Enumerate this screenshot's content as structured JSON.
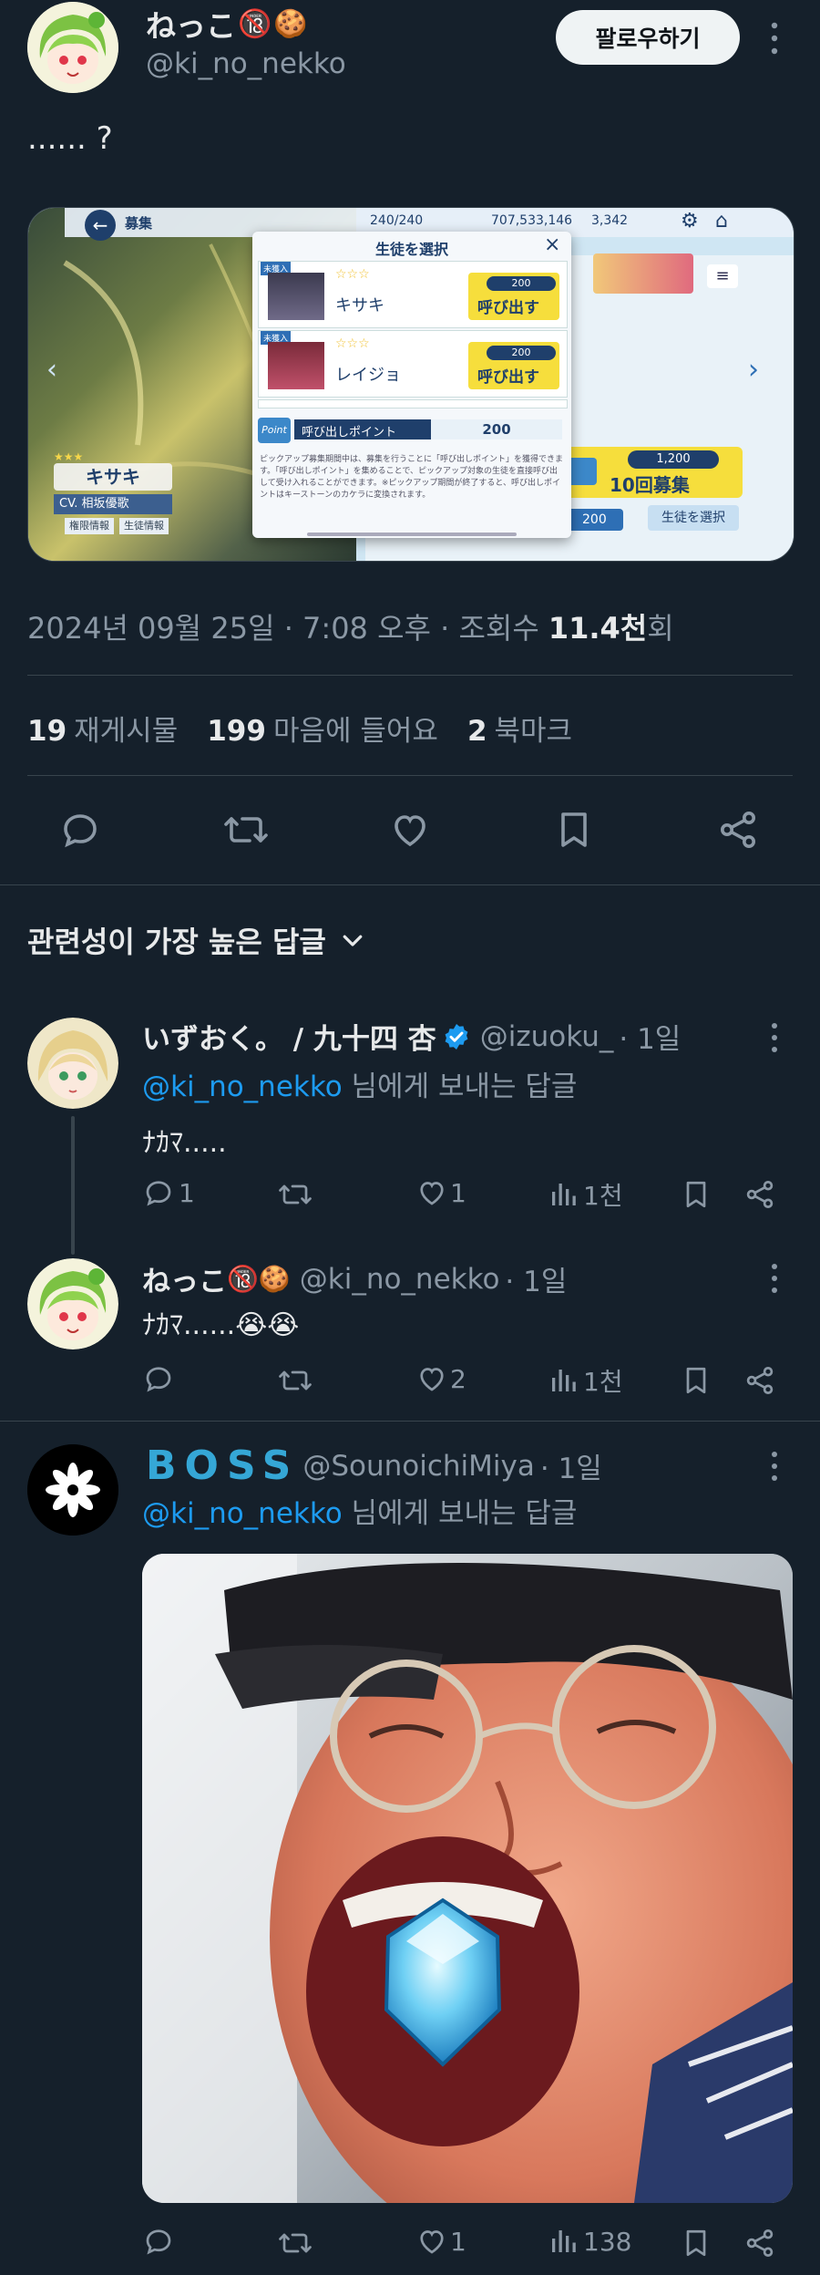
{
  "main_tweet": {
    "display_name": "ねっこ",
    "name_emoji_1": "🔞",
    "name_emoji_2": "🍪",
    "handle": "@ki_no_nekko",
    "follow_label": "팔로우하기",
    "text": "...... ?",
    "timestamp": "2024년 09월 25일 · 7:08 오후 · 조회수",
    "views": "11.4천",
    "views_suffix": "회",
    "retweets_count": "19",
    "retweets_label": "재게시물",
    "likes_count": "199",
    "likes_label": "마음에 들어요",
    "bookmarks_count": "2",
    "bookmarks_label": "북마크"
  },
  "embedded_game": {
    "header_title": "募集",
    "ap": "240/240",
    "credits": "707,533,146",
    "gems": "3,342",
    "dialog_title": "生徒を選択",
    "students": [
      {
        "badge": "未獲入",
        "name": "キサキ",
        "cost": "200",
        "button": "呼び出す"
      },
      {
        "badge": "未獲入",
        "name": "レイジョ",
        "cost": "200",
        "button": "呼び出す"
      }
    ],
    "point_label": "呼び出しポイント",
    "point_value": "200",
    "point_tag": "Point",
    "note_text": "ピックアップ募集期間中は、募集を行うことに「呼び出しポイント」を獲得できます。「呼び出しポイント」を集めることで、ピックアップ対象の生徒を直接呼び出して受け入れることができます。※ピックアップ期間が終了すると、呼び出しポイントはキーストーンのカケラに変換されます。",
    "char_name": "キサキ",
    "char_cv": "CV. 相坂優歌",
    "char_btn1": "権限情報",
    "char_btn2": "生徒情報",
    "recruit_cost": "1,200",
    "recruit_label": "10回募集",
    "select_btn": "生徒を選択",
    "small_num": "200"
  },
  "sort": {
    "label": "관련성이 가장 높은 답글"
  },
  "replies": [
    {
      "display_name": "いずおく。 / 九十四 杏",
      "handle": "@izuoku_",
      "time": "· 1일",
      "reply_to_handle": "@ki_no_nekko",
      "reply_to_suffix": " 님에게 보내는 답글",
      "text": "ﾅｶﾏ.....",
      "replies": "1",
      "likes": "1",
      "views": "1천"
    },
    {
      "display_name": "ねっこ",
      "name_emoji_1": "🔞",
      "name_emoji_2": "🍪",
      "handle": "@ki_no_nekko",
      "time": "· 1일",
      "text": "ﾅｶﾏ......",
      "text_emoji": "😭😭",
      "replies": "",
      "likes": "2",
      "views": "1천"
    },
    {
      "display_name": "BOSS",
      "handle": "@SounoichiMiya",
      "time": "· 1일",
      "reply_to_handle": "@ki_no_nekko",
      "reply_to_suffix": " 님에게 보내는 답글",
      "replies": "",
      "likes": "1",
      "views": "138"
    }
  ],
  "colors": {
    "background": "#15202b",
    "accent": "#1d9bf0",
    "muted": "#8b98a5",
    "boss": "#35a7d6"
  }
}
